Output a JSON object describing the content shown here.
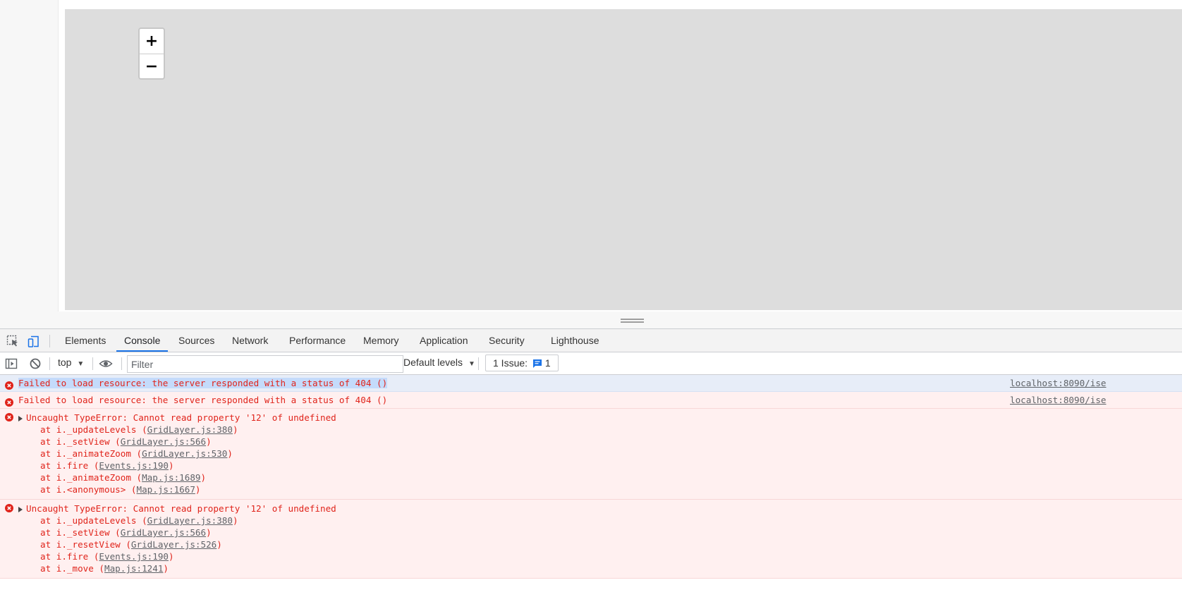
{
  "map": {
    "zoom_in": "+",
    "zoom_out": "−"
  },
  "devtools": {
    "tabs": [
      "Elements",
      "Console",
      "Sources",
      "Network",
      "Performance",
      "Memory",
      "Application",
      "Security",
      "Lighthouse"
    ],
    "active_tab": "Console",
    "toolbar": {
      "context": "top",
      "filter_placeholder": "Filter",
      "levels": "Default levels",
      "issues_label": "1 Issue:",
      "issues_count": "1"
    }
  },
  "console": {
    "messages": [
      {
        "level": "error",
        "text": "Failed to load resource: the server responded with a status of 404 ()",
        "source": "localhost:8090/ise",
        "selected": true
      },
      {
        "level": "error",
        "text": "Failed to load resource: the server responded with a status of 404 ()",
        "source": "localhost:8090/ise"
      },
      {
        "level": "error",
        "text": "Uncaught TypeError: Cannot read property '12' of undefined",
        "stack": [
          {
            "fn": "i._updateLevels",
            "loc": "GridLayer.js:380"
          },
          {
            "fn": "i._setView",
            "loc": "GridLayer.js:566"
          },
          {
            "fn": "i._animateZoom",
            "loc": "GridLayer.js:530"
          },
          {
            "fn": "i.fire",
            "loc": "Events.js:190"
          },
          {
            "fn": "i._animateZoom",
            "loc": "Map.js:1689"
          },
          {
            "fn": "i.<anonymous>",
            "loc": "Map.js:1667"
          }
        ]
      },
      {
        "level": "error",
        "text": "Uncaught TypeError: Cannot read property '12' of undefined",
        "stack": [
          {
            "fn": "i._updateLevels",
            "loc": "GridLayer.js:380"
          },
          {
            "fn": "i._setView",
            "loc": "GridLayer.js:566"
          },
          {
            "fn": "i._resetView",
            "loc": "GridLayer.js:526"
          },
          {
            "fn": "i.fire",
            "loc": "Events.js:190"
          },
          {
            "fn": "i._move",
            "loc": "Map.js:1241"
          }
        ]
      }
    ]
  }
}
